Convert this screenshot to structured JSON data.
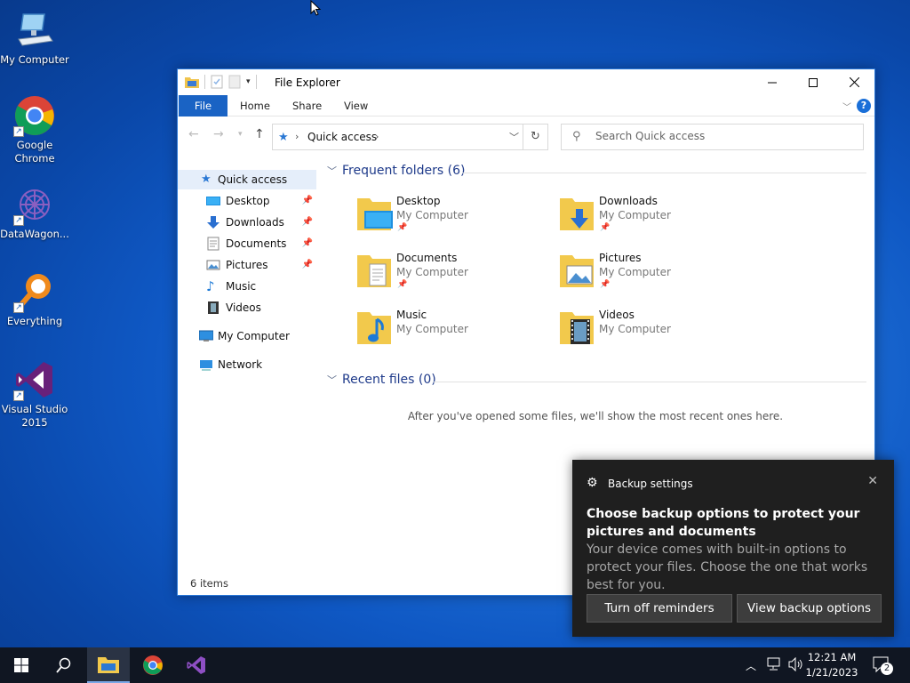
{
  "desktop": {
    "icons": [
      {
        "label": "My Computer"
      },
      {
        "label": "Google Chrome"
      },
      {
        "label": "DataWagon..."
      },
      {
        "label": "Everything"
      },
      {
        "label": "Visual Studio 2015"
      }
    ]
  },
  "explorer": {
    "title": "File Explorer",
    "tabs": {
      "file": "File",
      "home": "Home",
      "share": "Share",
      "view": "View"
    },
    "address": {
      "location": "Quick access"
    },
    "search": {
      "placeholder": "Search Quick access"
    },
    "nav": {
      "quick_access": "Quick access",
      "items": [
        "Desktop",
        "Downloads",
        "Documents",
        "Pictures",
        "Music",
        "Videos"
      ],
      "my_computer": "My Computer",
      "network": "Network"
    },
    "frequent": {
      "header": "Frequent folders (6)",
      "folders": [
        {
          "name": "Desktop",
          "location": "My Computer"
        },
        {
          "name": "Downloads",
          "location": "My Computer"
        },
        {
          "name": "Documents",
          "location": "My Computer"
        },
        {
          "name": "Pictures",
          "location": "My Computer"
        },
        {
          "name": "Music",
          "location": "My Computer"
        },
        {
          "name": "Videos",
          "location": "My Computer"
        }
      ]
    },
    "recent": {
      "header": "Recent files (0)",
      "empty_message": "After you've opened some files, we'll show the most recent ones here."
    },
    "status": "6 items"
  },
  "toast": {
    "app_name": "Backup settings",
    "headline": "Choose backup options to protect your pictures and documents",
    "body": "Your device comes with built-in options to protect your files. Choose the one that works best for you.",
    "buttons": {
      "turn_off": "Turn off reminders",
      "view": "View backup options"
    }
  },
  "taskbar": {
    "clock_time": "12:21 AM",
    "clock_date": "1/21/2023",
    "notification_count": "2"
  },
  "colors": {
    "accent": "#1a63c4",
    "toast_bg": "#1f1f1f",
    "taskbar_bg": "#101622"
  }
}
